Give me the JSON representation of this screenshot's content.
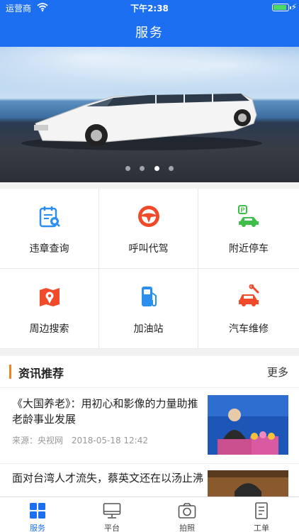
{
  "status_bar": {
    "carrier": "运营商",
    "time": "下午2:38"
  },
  "header": {
    "title": "服务"
  },
  "banner": {
    "slide_count": 4,
    "active_slide": 3
  },
  "services": [
    {
      "label": "违章查询",
      "icon": "violation-query-icon"
    },
    {
      "label": "呼叫代驾",
      "icon": "steering-wheel-icon"
    },
    {
      "label": "附近停车",
      "icon": "parking-icon"
    },
    {
      "label": "周边搜索",
      "icon": "map-pin-icon"
    },
    {
      "label": "加油站",
      "icon": "gas-pump-icon"
    },
    {
      "label": "汽车维修",
      "icon": "car-repair-icon"
    }
  ],
  "news": {
    "title": "资讯推荐",
    "more": "更多",
    "items": [
      {
        "title": "《大国养老》：用初心和影像的力量助推老龄事业发展",
        "source": "来源：央视网",
        "date": "2018-05-18 12:42"
      },
      {
        "title": "面对台湾人才流失，蔡英文还在以汤止沸"
      }
    ]
  },
  "tabbar": {
    "items": [
      {
        "label": "服务",
        "icon": "grid-icon",
        "active": true
      },
      {
        "label": "平台",
        "icon": "monitor-icon",
        "active": false
      },
      {
        "label": "拍照",
        "icon": "camera-icon",
        "active": false
      },
      {
        "label": "工单",
        "icon": "document-icon",
        "active": false
      }
    ]
  },
  "colors": {
    "primary": "#1d6ff2",
    "accent": "#f2821d",
    "icon_blue": "#2b8ff0",
    "icon_red": "#f04a2a",
    "icon_green": "#3fbf4a"
  }
}
